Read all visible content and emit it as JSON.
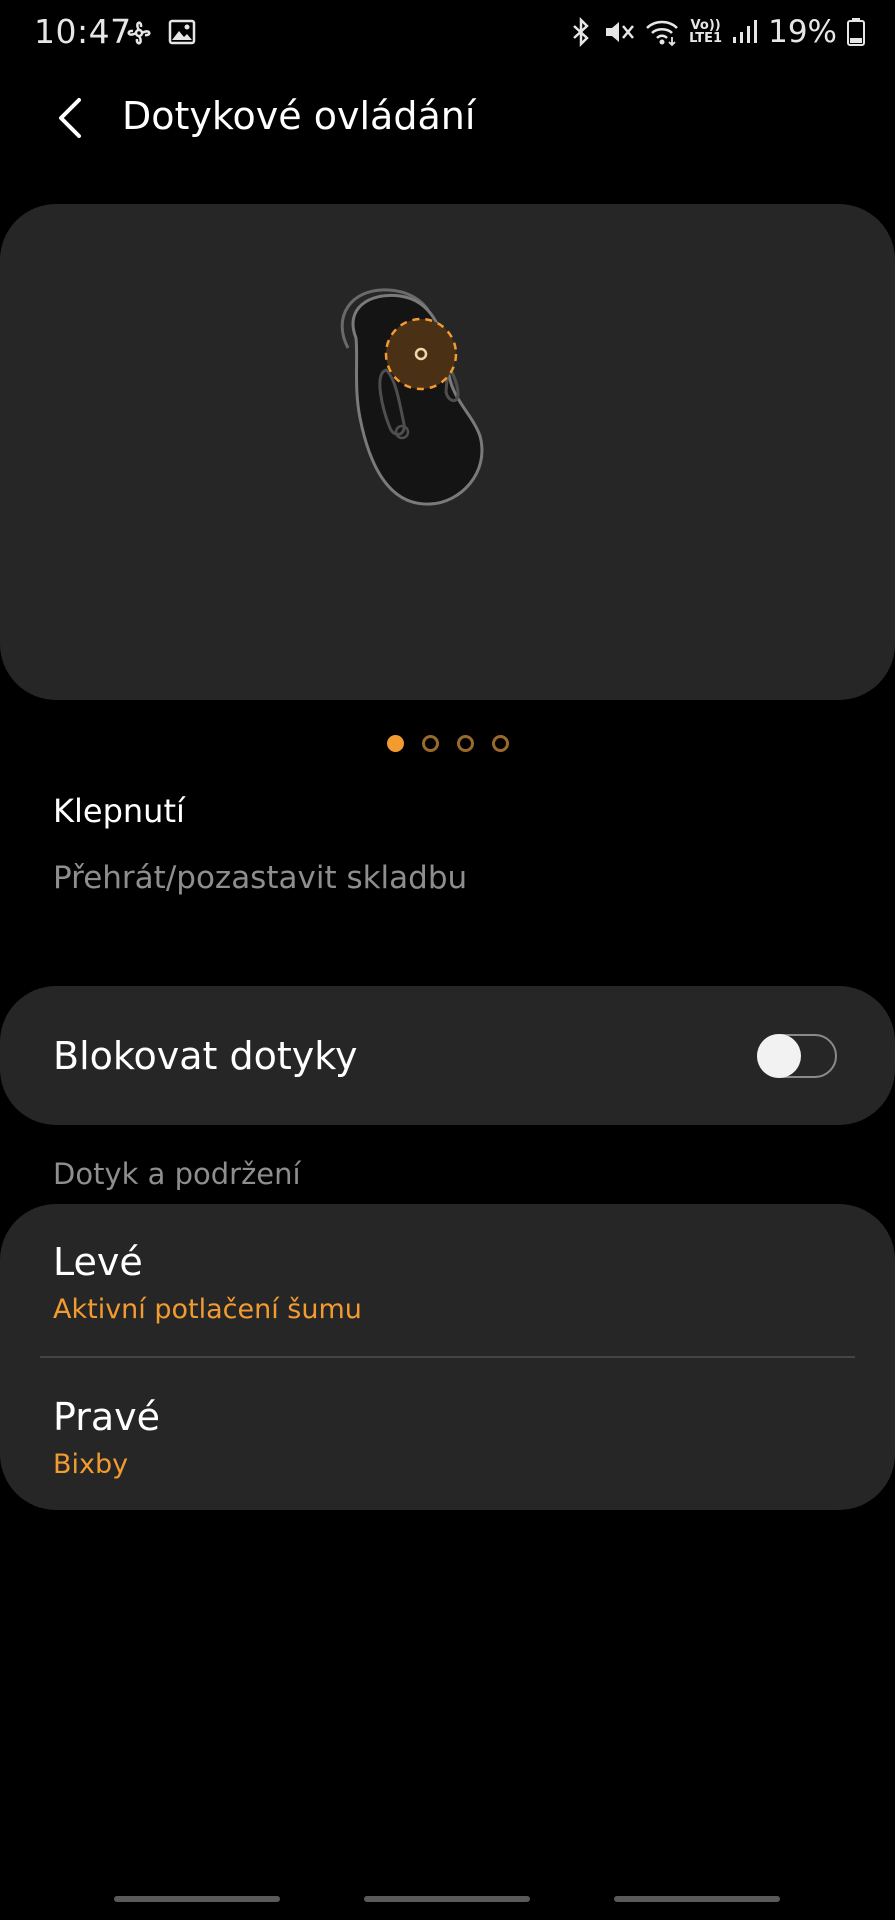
{
  "status_bar": {
    "time": "10:47",
    "left_icons": [
      "fan-icon",
      "image-icon"
    ],
    "right_icons": [
      "bluetooth-icon",
      "mute-icon",
      "wifi-icon",
      "volte-icon",
      "signal-icon"
    ],
    "volte_top": "Vo))",
    "volte_bottom": "LTE1",
    "battery_percent": "19%"
  },
  "header": {
    "title": "Dotykové ovládání"
  },
  "illustration": {
    "accent_color": "#f29b30",
    "page_count": 4,
    "active_page": 1
  },
  "gesture": {
    "title": "Klepnutí",
    "description": "Přehrát/pozastavit skladbu"
  },
  "block_touch": {
    "label": "Blokovat dotyky",
    "enabled": false
  },
  "hold_section": {
    "heading": "Dotyk a podržení",
    "items": [
      {
        "title": "Levé",
        "value": "Aktivní potlačení šumu"
      },
      {
        "title": "Pravé",
        "value": "Bixby"
      }
    ]
  },
  "colors": {
    "background": "#000000",
    "card": "#262626",
    "accent": "#f29b30",
    "secondary_text": "#8e8e8e"
  }
}
